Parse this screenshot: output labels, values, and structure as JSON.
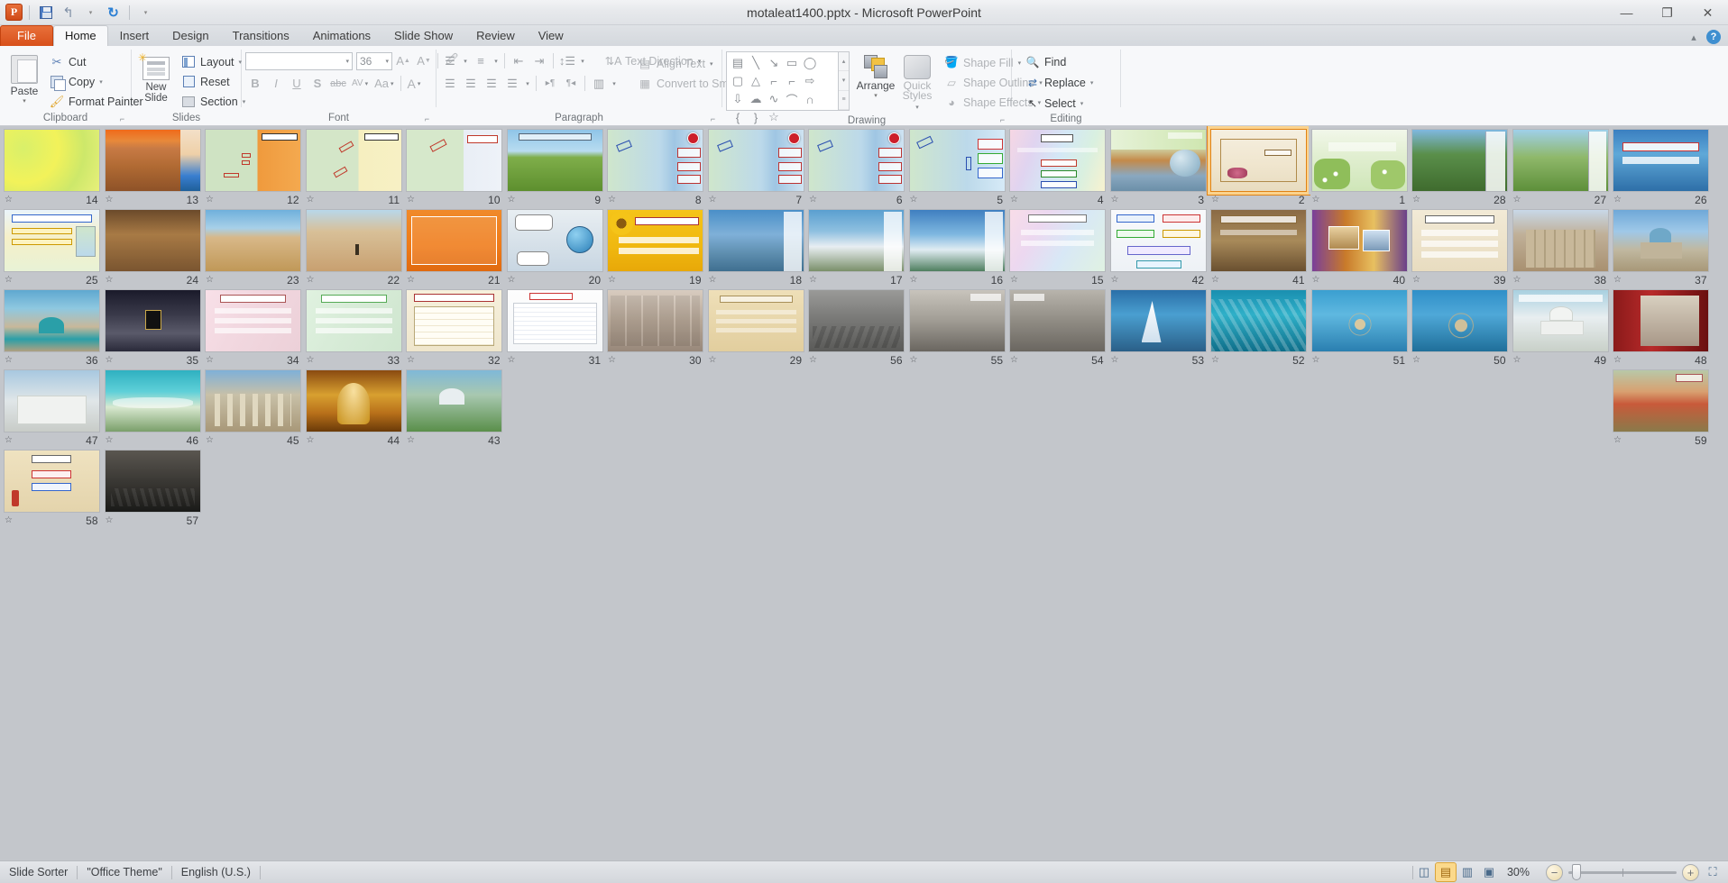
{
  "window": {
    "title": "motaleat1400.pptx  -  Microsoft PowerPoint",
    "app_logo": "powerpoint-logo",
    "minimize": "—",
    "restore": "❐",
    "close": "✕"
  },
  "quick_access": {
    "save": "save-icon",
    "undo": "undo-icon",
    "undo_caret": "▾",
    "redo": "redo-icon",
    "customize": "▾"
  },
  "tabs": [
    {
      "label": "File",
      "id": "tab-file",
      "active": false,
      "file": true
    },
    {
      "label": "Home",
      "id": "tab-home",
      "active": true
    },
    {
      "label": "Insert",
      "id": "tab-insert",
      "active": false
    },
    {
      "label": "Design",
      "id": "tab-design",
      "active": false
    },
    {
      "label": "Transitions",
      "id": "tab-transitions",
      "active": false
    },
    {
      "label": "Animations",
      "id": "tab-animations",
      "active": false
    },
    {
      "label": "Slide Show",
      "id": "tab-slideshow",
      "active": false
    },
    {
      "label": "Review",
      "id": "tab-review",
      "active": false
    },
    {
      "label": "View",
      "id": "tab-view",
      "active": false
    }
  ],
  "tab_right": {
    "minimize_ribbon": "▴",
    "help": "?"
  },
  "ribbon": {
    "clipboard": {
      "label": "Clipboard",
      "paste": "Paste",
      "paste_caret": "▾",
      "cut": "Cut",
      "copy": "Copy",
      "copy_caret": "▾",
      "format_painter": "Format Painter",
      "launcher": "⌐"
    },
    "slides": {
      "label": "Slides",
      "new_slide": "New Slide",
      "new_slide_caret": "▾",
      "layout": "Layout",
      "layout_caret": "▾",
      "reset": "Reset",
      "section": "Section",
      "section_caret": "▾"
    },
    "font": {
      "label": "Font",
      "font_name_value": "",
      "font_name_caret": "▾",
      "font_size_value": "36",
      "font_size_caret": "▾",
      "grow_font": "A▴",
      "shrink_font": "A▾",
      "clear_formatting": "clear-formatting-icon",
      "bold": "B",
      "italic": "I",
      "underline": "U",
      "shadow": "S",
      "strikethrough": "abc",
      "character_spacing": "AV",
      "change_case": "Aa",
      "change_case_caret": "▾",
      "font_color": "A",
      "font_color_caret": "▾",
      "launcher": "⌐"
    },
    "paragraph": {
      "label": "Paragraph",
      "bullets": "bullets-icon",
      "bullets_caret": "▾",
      "numbering": "numbering-icon",
      "numbering_caret": "▾",
      "decrease_indent": "decrease-indent-icon",
      "increase_indent": "increase-indent-icon",
      "line_spacing": "line-spacing-icon",
      "line_spacing_caret": "▾",
      "align_left": "align-left-icon",
      "align_center": "align-center-icon",
      "align_right": "align-right-icon",
      "justify": "justify-icon",
      "justify_caret": "▾",
      "ltr": "▸¶",
      "rtl": "¶◂",
      "columns": "columns-icon",
      "columns_caret": "▾",
      "text_direction": "Text Direction",
      "text_direction_caret": "▾",
      "align_text": "Align Text",
      "align_text_caret": "▾",
      "convert_to_smartart": "Convert to SmartArt",
      "convert_caret": "▾",
      "launcher": "⌐"
    },
    "drawing": {
      "label": "Drawing",
      "shapes": [
        "textbox",
        "line",
        "arrow",
        "rectangle",
        "oval",
        "rounded-rectangle",
        "triangle",
        "elbow-connector",
        "elbow-arrow-connector",
        "right-arrow",
        "down-arrow",
        "cloud",
        "freeform",
        "arc",
        "curve",
        "left-brace",
        "right-brace",
        "star"
      ],
      "scroll_up": "▴",
      "scroll_down": "▾",
      "more": "▾",
      "arrange": "Arrange",
      "arrange_caret": "▾",
      "quick_styles_1": "Quick",
      "quick_styles_2": "Styles",
      "quick_styles_caret": "▾",
      "shape_fill": "Shape Fill",
      "shape_fill_caret": "▾",
      "shape_outline": "Shape Outline",
      "shape_outline_caret": "▾",
      "shape_effects": "Shape Effects",
      "shape_effects_caret": "▾",
      "launcher": "⌐"
    },
    "editing": {
      "label": "Editing",
      "find": "Find",
      "replace": "Replace",
      "replace_caret": "▾",
      "select": "Select",
      "select_caret": "▾"
    }
  },
  "status": {
    "view_mode": "Slide Sorter",
    "theme": "\"Office Theme\"",
    "language": "English (U.S.)",
    "views": [
      {
        "name": "normal-view-button",
        "glyph": "◫",
        "active": false
      },
      {
        "name": "slide-sorter-view-button",
        "glyph": "▤",
        "active": true
      },
      {
        "name": "reading-view-button",
        "glyph": "▥",
        "active": false
      },
      {
        "name": "slide-show-button",
        "glyph": "▣",
        "active": false
      }
    ],
    "zoom_percent": "30%",
    "zoom_out": "−",
    "zoom_in": "+",
    "fit_to_window": "fit-window-icon"
  },
  "slide_sorter": {
    "transition_icon": "transition-star-icon",
    "selected_slide": 2,
    "total_slides": 59,
    "slides": [
      {
        "num": 14,
        "style": "green-yellow-title",
        "row": 1
      },
      {
        "num": 13,
        "style": "desert-sunset",
        "row": 1
      },
      {
        "num": 12,
        "style": "map-orange-panel",
        "row": 1
      },
      {
        "num": 11,
        "style": "map-yellow-panel",
        "row": 1
      },
      {
        "num": 10,
        "style": "map-redbox",
        "row": 1
      },
      {
        "num": 9,
        "style": "field-green-sky",
        "row": 1
      },
      {
        "num": 8,
        "style": "map-question-badge",
        "row": 1
      },
      {
        "num": 7,
        "style": "map-question-badge",
        "row": 1
      },
      {
        "num": 6,
        "style": "map-question-badge",
        "row": 1
      },
      {
        "num": 5,
        "style": "map-labels-blue",
        "row": 1
      },
      {
        "num": 4,
        "style": "pastel-text-boxes",
        "row": 1
      },
      {
        "num": 3,
        "style": "oil-rig-collage",
        "row": 1
      },
      {
        "num": 2,
        "style": "cream-roses",
        "row": 1
      },
      {
        "num": 1,
        "style": "flowers-title",
        "row": 1
      },
      {
        "num": 28,
        "style": "photo-person-trees",
        "row": 2
      },
      {
        "num": 27,
        "style": "green-landscape",
        "row": 2
      },
      {
        "num": 26,
        "style": "blue-water-text",
        "row": 2
      },
      {
        "num": 25,
        "style": "yellow-notes-map",
        "row": 2
      },
      {
        "num": 24,
        "style": "desert-dunes-dark",
        "row": 2
      },
      {
        "num": 23,
        "style": "desert-blue-sky",
        "row": 2
      },
      {
        "num": 22,
        "style": "desert-walker",
        "row": 2
      },
      {
        "num": 21,
        "style": "orange-text-slide",
        "row": 2
      },
      {
        "num": 20,
        "style": "cartoon-globe",
        "row": 2
      },
      {
        "num": 19,
        "style": "yellow-sunflower",
        "row": 2
      },
      {
        "num": 18,
        "style": "blue-mountain",
        "row": 2
      },
      {
        "num": 17,
        "style": "snow-mountain",
        "row": 2
      },
      {
        "num": 16,
        "style": "snow-peak-blue",
        "row": 2
      },
      {
        "num": 15,
        "style": "pink-pastel-text",
        "row": 2
      },
      {
        "num": 42,
        "style": "white-boxes-diagram",
        "row": 3
      },
      {
        "num": 41,
        "style": "brown-ruins-text",
        "row": 3
      },
      {
        "num": 40,
        "style": "purple-collage",
        "row": 3
      },
      {
        "num": 39,
        "style": "beige-text-boxes",
        "row": 3
      },
      {
        "num": 38,
        "style": "ancient-ruins",
        "row": 3
      },
      {
        "num": 37,
        "style": "blue-dome-mosque",
        "row": 3
      },
      {
        "num": 36,
        "style": "turquoise-mosque",
        "row": 3
      },
      {
        "num": 35,
        "style": "kaaba-crowd",
        "row": 3
      },
      {
        "num": 34,
        "style": "pink-text-slide",
        "row": 3
      },
      {
        "num": 33,
        "style": "green-text-slide",
        "row": 3
      },
      {
        "num": 32,
        "style": "cream-table-slide",
        "row": 3
      },
      {
        "num": 31,
        "style": "white-table-grid",
        "row": 3
      },
      {
        "num": 30,
        "style": "people-faces-grid",
        "row": 3
      },
      {
        "num": 29,
        "style": "tan-parchment-text",
        "row": 3
      },
      {
        "num": 56,
        "style": "war-rubble-gray",
        "row": 4
      },
      {
        "num": 55,
        "style": "bombed-building",
        "row": 4
      },
      {
        "num": 54,
        "style": "destroyed-street",
        "row": 4
      },
      {
        "num": 53,
        "style": "burj-al-arab",
        "row": 4
      },
      {
        "num": 52,
        "style": "blue-glass-building",
        "row": 4
      },
      {
        "num": 51,
        "style": "palm-island",
        "row": 4
      },
      {
        "num": 50,
        "style": "palm-jumeirah",
        "row": 4
      },
      {
        "num": 49,
        "style": "white-mosque-dome",
        "row": 4
      },
      {
        "num": 48,
        "style": "red-museum-hall",
        "row": 4
      },
      {
        "num": 47,
        "style": "white-building-sky",
        "row": 4
      },
      {
        "num": 46,
        "style": "turquoise-beach",
        "row": 4
      },
      {
        "num": 45,
        "style": "roman-ruins-columns",
        "row": 4
      },
      {
        "num": 44,
        "style": "golden-mosque-interior",
        "row": 4
      },
      {
        "num": 43,
        "style": "green-mosque-garden",
        "row": 4
      },
      {
        "num": 59,
        "style": "poppy-field-hills",
        "row": 5
      },
      {
        "num": 58,
        "style": "parchment-diagram",
        "row": 5
      },
      {
        "num": 57,
        "style": "war-destruction-dark",
        "row": 5
      }
    ]
  }
}
